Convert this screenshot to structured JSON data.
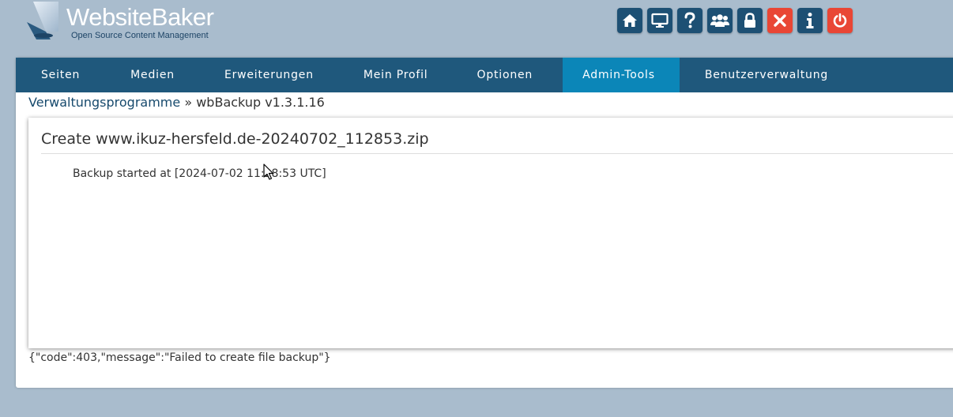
{
  "logo": {
    "name": "WebsiteBaker",
    "tagline": "Open Source Content Management"
  },
  "toolbar": [
    {
      "name": "home-icon",
      "color": "#1d5074"
    },
    {
      "name": "monitor-icon",
      "color": "#1d5074"
    },
    {
      "name": "help-icon",
      "color": "#1d5074"
    },
    {
      "name": "users-icon",
      "color": "#1d5074"
    },
    {
      "name": "lock-icon",
      "color": "#1d5074"
    },
    {
      "name": "close-icon",
      "color": "#e94635"
    },
    {
      "name": "info-icon",
      "color": "#1d5074"
    },
    {
      "name": "power-icon",
      "color": "#e94635"
    }
  ],
  "nav": {
    "items": [
      {
        "label": "Seiten"
      },
      {
        "label": "Medien"
      },
      {
        "label": "Erweiterungen"
      },
      {
        "label": "Mein Profil"
      },
      {
        "label": "Optionen"
      },
      {
        "label": "Admin-Tools",
        "active": true
      },
      {
        "label": "Benutzerverwaltung"
      }
    ]
  },
  "breadcrumb": {
    "link": "Verwaltungsprogramme",
    "separator": "»",
    "current": "wbBackup v1.3.1.16"
  },
  "dialog": {
    "title": "Create www.ikuz-hersfeld.de-20240702_112853.zip",
    "log": "Backup started at [2024-07-02 11:28:53 UTC]"
  },
  "response": "{\"code\":403,\"message\":\"Failed to create file backup\"}",
  "colors": {
    "background": "#a9bccd",
    "nav": "#1f587c",
    "nav_active": "#0b86b8",
    "button": "#1d5074",
    "button_danger": "#e94635"
  }
}
